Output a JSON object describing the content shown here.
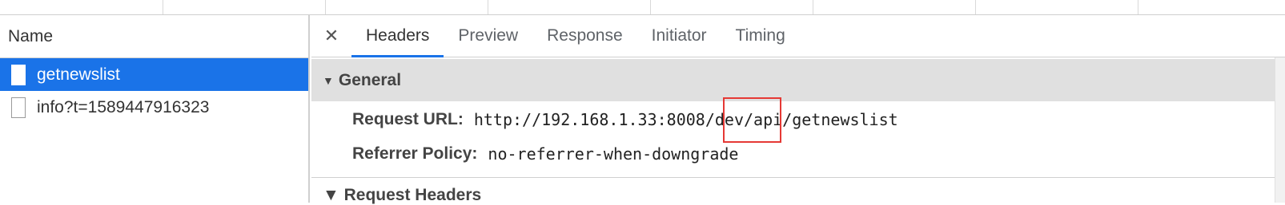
{
  "requests_panel": {
    "column_header": "Name",
    "items": [
      {
        "label": "getnewslist",
        "selected": true
      },
      {
        "label": "info?t=1589447916323",
        "selected": false
      }
    ]
  },
  "details_panel": {
    "close_symbol": "✕",
    "tabs": [
      {
        "label": "Headers",
        "active": true
      },
      {
        "label": "Preview",
        "active": false
      },
      {
        "label": "Response",
        "active": false
      },
      {
        "label": "Initiator",
        "active": false
      },
      {
        "label": "Timing",
        "active": false
      }
    ],
    "general": {
      "expand_symbol": "▼",
      "title": "General",
      "request_url_key": "Request URL:",
      "request_url_value": "http://192.168.1.33:8008/dev/api/getnewslist",
      "referrer_policy_key": "Referrer Policy:",
      "referrer_policy_value": "no-referrer-when-downgrade"
    },
    "next_section_title": "▼ Request Headers"
  },
  "colors": {
    "selection": "#1a73e8",
    "highlight_box": "#e53935",
    "section_bg": "#e0e0e0"
  }
}
